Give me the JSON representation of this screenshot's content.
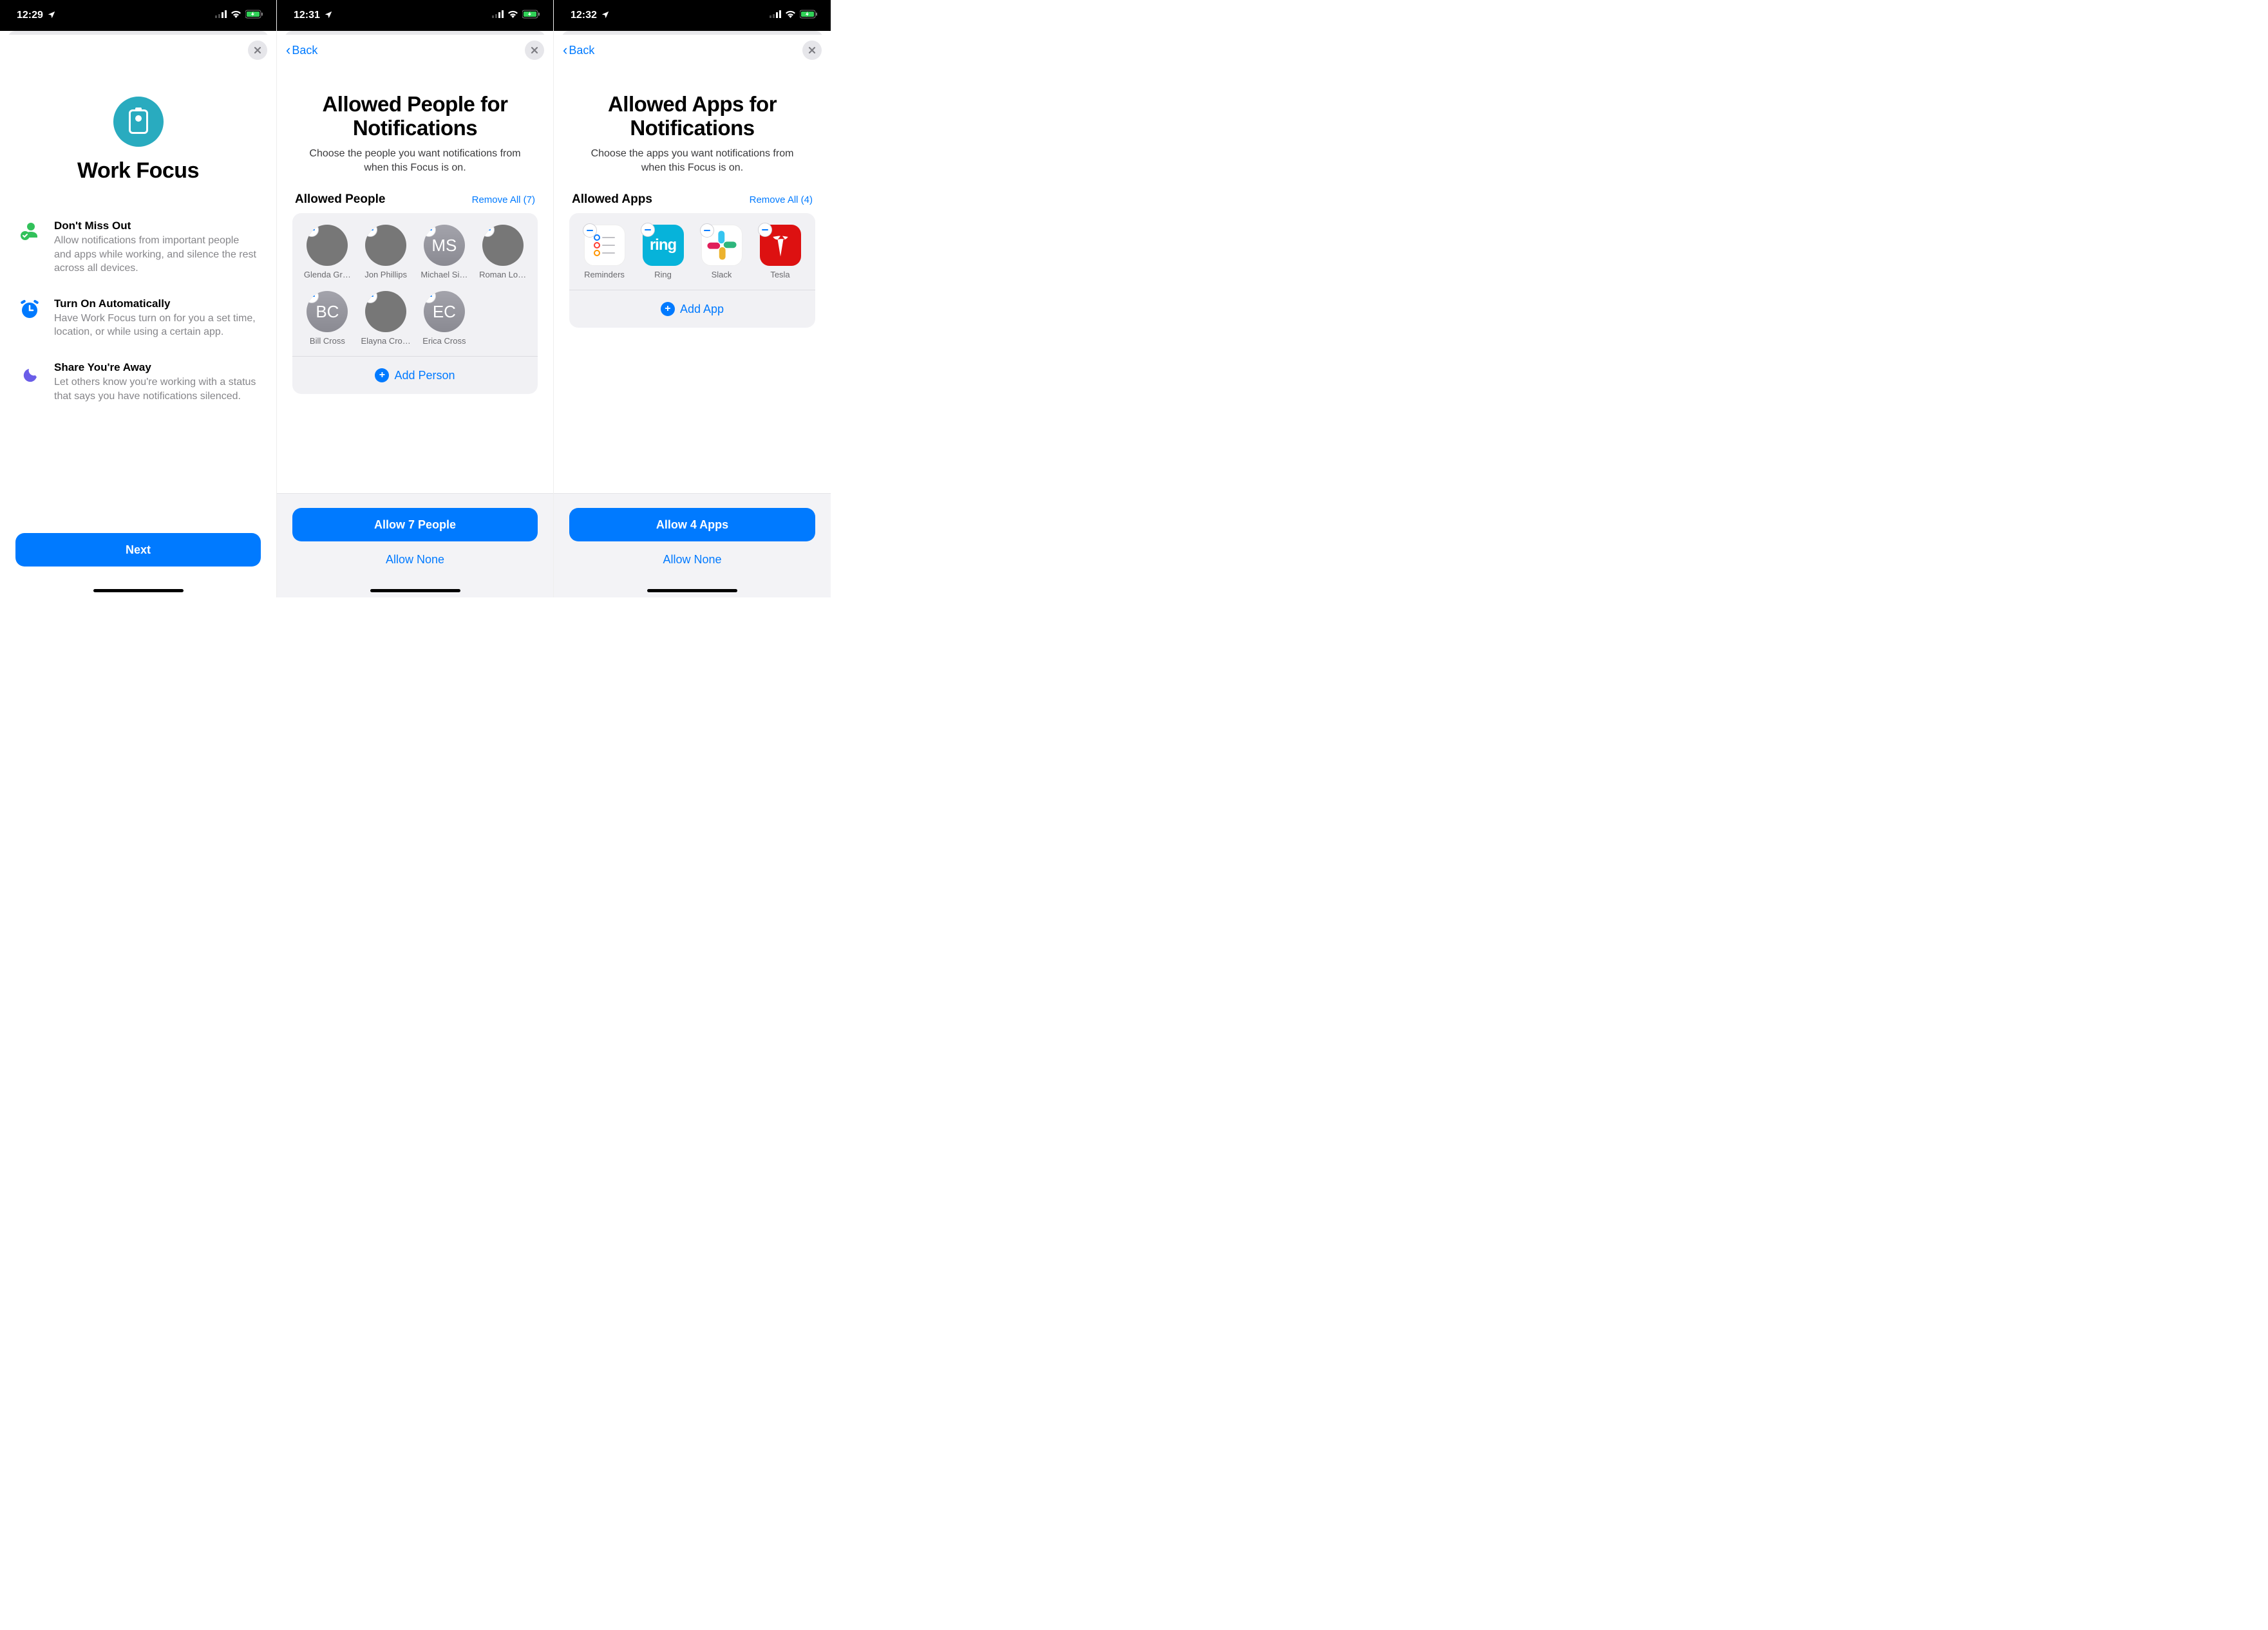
{
  "status": {
    "time1": "12:29",
    "time2": "12:31",
    "time3": "12:32"
  },
  "screen1": {
    "title": "Work Focus",
    "features": [
      {
        "title": "Don't Miss Out",
        "desc": "Allow notifications from important people and apps while working, and silence the rest across all devices."
      },
      {
        "title": "Turn On Automatically",
        "desc": "Have Work Focus turn on for you a set time, location, or while using a certain app."
      },
      {
        "title": "Share You're Away",
        "desc": "Let others know you're working with a status that says you have notifications silenced."
      }
    ],
    "next": "Next"
  },
  "screen2": {
    "back": "Back",
    "heading": "Allowed People for Notifications",
    "desc": "Choose the people you want notifications from when this Focus is on.",
    "section": "Allowed People",
    "remove_all": "Remove All (7)",
    "people": [
      {
        "name": "Glenda Gr…",
        "initials": "",
        "photo": true,
        "cls": "ph1"
      },
      {
        "name": "Jon Phillips",
        "initials": "",
        "photo": true,
        "cls": "ph2"
      },
      {
        "name": "Michael Si…",
        "initials": "MS",
        "photo": false
      },
      {
        "name": "Roman Lo…",
        "initials": "",
        "photo": true,
        "cls": "ph3"
      },
      {
        "name": "Bill Cross",
        "initials": "BC",
        "photo": false
      },
      {
        "name": "Elayna Cro…",
        "initials": "",
        "photo": true,
        "cls": "ph4"
      },
      {
        "name": "Erica Cross",
        "initials": "EC",
        "photo": false
      }
    ],
    "add": "Add Person",
    "allow_primary": "Allow 7 People",
    "allow_none": "Allow None"
  },
  "screen3": {
    "back": "Back",
    "heading": "Allowed Apps for Notifications",
    "desc": "Choose the apps you want notifications from when this Focus is on.",
    "section": "Allowed Apps",
    "remove_all": "Remove All (4)",
    "apps": [
      {
        "name": "Reminders",
        "cls": "app-reminders"
      },
      {
        "name": "Ring",
        "cls": "app-ring",
        "text": "ring"
      },
      {
        "name": "Slack",
        "cls": "app-slack"
      },
      {
        "name": "Tesla",
        "cls": "app-tesla"
      }
    ],
    "add": "Add App",
    "allow_primary": "Allow 4 Apps",
    "allow_none": "Allow None"
  }
}
